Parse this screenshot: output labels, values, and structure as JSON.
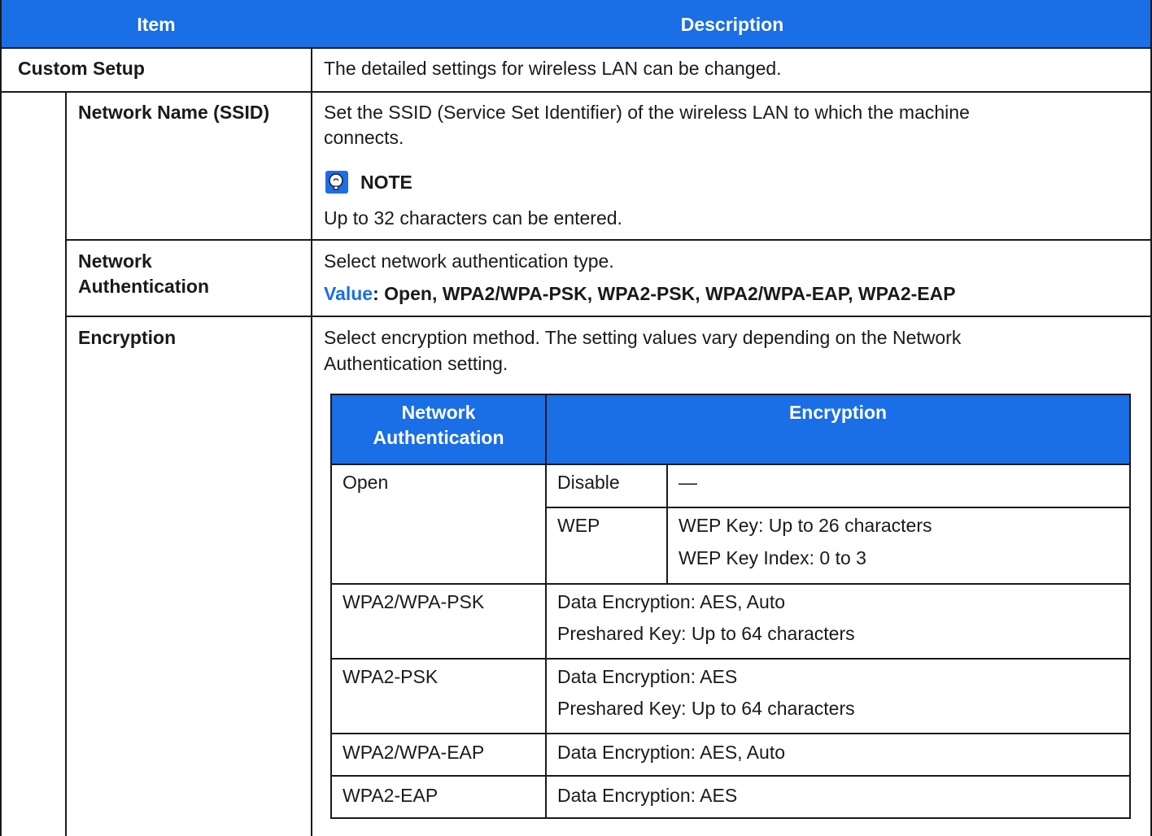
{
  "colors": {
    "header_bg": "#1a6ee6",
    "border": "#1a1a1a",
    "value_label": "#1a6ee6"
  },
  "header": {
    "item": "Item",
    "description": "Description"
  },
  "rows": {
    "custom_setup": {
      "item": "Custom Setup",
      "description": "The detailed settings for wireless LAN can be changed."
    },
    "ssid": {
      "item": "Network Name (SSID)",
      "description_line1": "Set the SSID (Service Set Identifier) of the wireless LAN to which the machine",
      "description_line2": "connects.",
      "note_icon": "note-lightbulb-icon",
      "note_title": "NOTE",
      "note_text": "Up to 32 characters can be entered."
    },
    "auth": {
      "item_line1": "Network",
      "item_line2": "Authentication",
      "description": "Select network authentication type.",
      "value_label": "Value",
      "value_text": ": Open, WPA2/WPA-PSK, WPA2-PSK, WPA2/WPA-EAP, WPA2-EAP"
    },
    "encryption": {
      "item": "Encryption",
      "description_line1": "Select encryption method. The setting values vary depending on the Network",
      "description_line2": "Authentication setting."
    }
  },
  "inner_table": {
    "header_auth_line1": "Network",
    "header_auth_line2": "Authentication",
    "header_encryption": "Encryption",
    "open": {
      "auth": "Open",
      "disable_label": "Disable",
      "disable_value": "—",
      "wep_label": "WEP",
      "wep_line1": "WEP Key: Up to 26 characters",
      "wep_line2": "WEP Key Index: 0 to 3"
    },
    "wpa2_wpa_psk": {
      "auth": "WPA2/WPA-PSK",
      "line1": "Data Encryption: AES, Auto",
      "line2": "Preshared Key: Up to 64 characters"
    },
    "wpa2_psk": {
      "auth": "WPA2-PSK",
      "line1": "Data Encryption: AES",
      "line2": "Preshared Key: Up to 64 characters"
    },
    "wpa2_wpa_eap": {
      "auth": "WPA2/WPA-EAP",
      "line1": "Data Encryption: AES, Auto"
    },
    "wpa2_eap": {
      "auth": "WPA2-EAP",
      "line1": "Data Encryption: AES"
    }
  }
}
